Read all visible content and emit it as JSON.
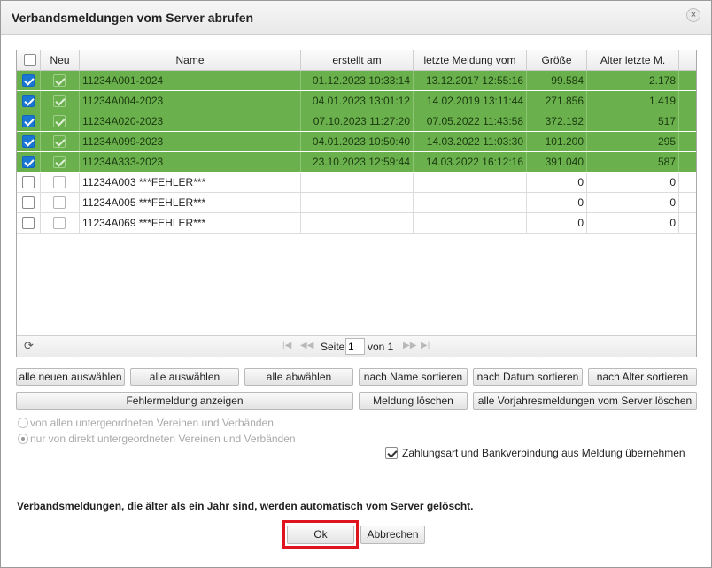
{
  "dialog": {
    "title": "Verbandsmeldungen vom Server abrufen",
    "close_glyph": "×"
  },
  "grid": {
    "headers": {
      "select": "",
      "neu": "Neu",
      "name": "Name",
      "erstellt": "erstellt am",
      "letzte": "letzte Meldung vom",
      "groesse": "Größe",
      "alter": "Alter letzte M."
    },
    "rows": [
      {
        "selected": true,
        "neu": true,
        "name": "11234A001-2024",
        "erstellt": "01.12.2023 10:33:14",
        "letzte": "13.12.2017 12:55:16",
        "groesse": "99.584",
        "alter": "2.178"
      },
      {
        "selected": true,
        "neu": true,
        "name": "11234A004-2023",
        "erstellt": "04.01.2023 13:01:12",
        "letzte": "14.02.2019 13:11:44",
        "groesse": "271.856",
        "alter": "1.419"
      },
      {
        "selected": true,
        "neu": true,
        "name": "11234A020-2023",
        "erstellt": "07.10.2023 11:27:20",
        "letzte": "07.05.2022 11:43:58",
        "groesse": "372.192",
        "alter": "517"
      },
      {
        "selected": true,
        "neu": true,
        "name": "11234A099-2023",
        "erstellt": "04.01.2023 10:50:40",
        "letzte": "14.03.2022 11:03:30",
        "groesse": "101.200",
        "alter": "295"
      },
      {
        "selected": true,
        "neu": true,
        "name": "11234A333-2023",
        "erstellt": "23.10.2023 12:59:44",
        "letzte": "14.03.2022 16:12:16",
        "groesse": "391.040",
        "alter": "587"
      },
      {
        "selected": false,
        "neu": false,
        "name": "11234A003 ***FEHLER***",
        "erstellt": "",
        "letzte": "",
        "groesse": "0",
        "alter": "0"
      },
      {
        "selected": false,
        "neu": false,
        "name": "11234A005 ***FEHLER***",
        "erstellt": "",
        "letzte": "",
        "groesse": "0",
        "alter": "0"
      },
      {
        "selected": false,
        "neu": false,
        "name": "11234A069 ***FEHLER***",
        "erstellt": "",
        "letzte": "",
        "groesse": "0",
        "alter": "0"
      }
    ],
    "pager": {
      "page_label": "Seite",
      "page_value": "1",
      "of_label": "von 1",
      "refresh_icon": "refresh-icon"
    }
  },
  "buttons": {
    "select_new": "alle neuen auswählen",
    "select_all": "alle auswählen",
    "deselect_all": "alle abwählen",
    "sort_name": "nach Name sortieren",
    "sort_date": "nach Datum sortieren",
    "sort_age": "nach Alter sortieren",
    "show_error": "Fehlermeldung anzeigen",
    "delete_message": "Meldung löschen",
    "delete_prev_year": "alle Vorjahresmeldungen vom Server löschen",
    "ok": "Ok",
    "cancel": "Abbrechen"
  },
  "options": {
    "radio_all": "von allen untergeordneten Vereinen und Verbänden",
    "radio_direct": "nur von direkt untergeordneten Vereinen und Verbänden",
    "payment_checkbox": "Zahlungsart und Bankverbindung aus Meldung übernehmen",
    "payment_checked": true
  },
  "footnote": "Verbandsmeldungen, die älter als ein Jahr sind, werden automatisch vom Server gelöscht.",
  "colors": {
    "row_ok": "#6ab04c",
    "checkbox_selected": "#1976d2",
    "highlight_frame": "#e0141e"
  }
}
